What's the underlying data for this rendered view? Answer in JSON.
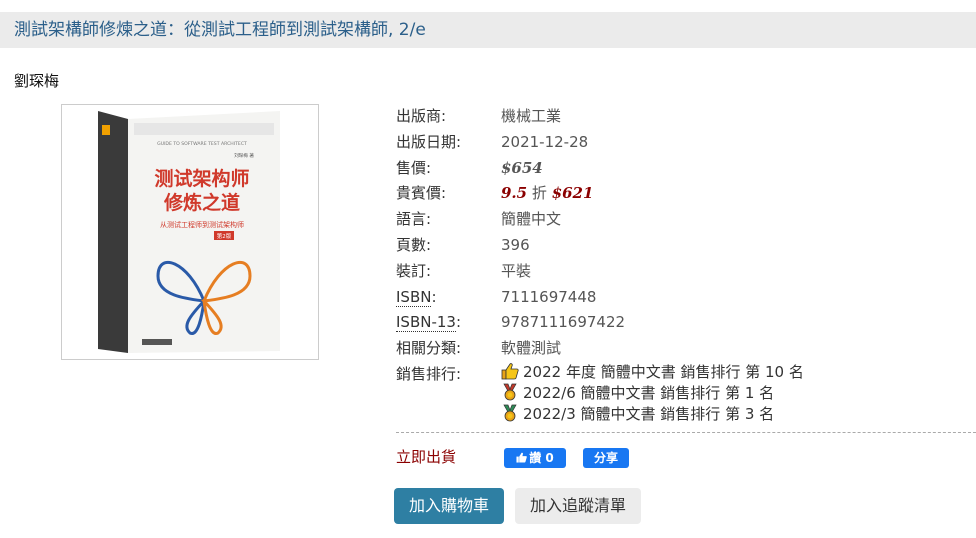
{
  "book": {
    "title": "測試架構師修煉之道：從測試工程師到測試架構師, 2/e",
    "author": "劉琛梅",
    "cover": {
      "title_line1": "测试架构师",
      "title_line2": "修炼之道",
      "en_subtitle": "GUIDE TO SOFTWARE TEST ARCHITECT",
      "cn_subtitle": "从测试工程师到测试架构师",
      "edition": "第2版",
      "author_line": "刘琛梅 著"
    }
  },
  "details": {
    "publisher": {
      "label": "出版商:",
      "value": "機械工業"
    },
    "pub_date": {
      "label": "出版日期:",
      "value": "2021-12-28"
    },
    "price": {
      "label": "售價:",
      "value": "$654"
    },
    "vip_price": {
      "label": "貴賓價:",
      "discount": "9.5",
      "discount_unit": "折",
      "value": "$621"
    },
    "language": {
      "label": "語言:",
      "value": "簡體中文"
    },
    "pages": {
      "label": "頁數:",
      "value": "396"
    },
    "binding": {
      "label": "裝訂:",
      "value": "平裝"
    },
    "isbn": {
      "label": "ISBN",
      "colon": ":",
      "value": "7111697448"
    },
    "isbn13": {
      "label": "ISBN-13",
      "colon": ":",
      "value": "9787111697422"
    },
    "category": {
      "label": "相關分類:",
      "value": "軟體測試"
    },
    "rankings": {
      "label": "銷售排行:",
      "items": [
        {
          "icon": "thumbs-up-icon",
          "text": "2022 年度 簡體中文書 銷售排行 第 10 名"
        },
        {
          "icon": "medal-icon",
          "text": "2022/6 簡體中文書 銷售排行 第 1 名"
        },
        {
          "icon": "medal-icon",
          "text": "2022/3 簡體中文書 銷售排行 第 3 名"
        }
      ]
    }
  },
  "stock_status": "立即出貨",
  "social": {
    "like_label": "讚 0",
    "share_label": "分享"
  },
  "actions": {
    "add_to_cart": "加入購物車",
    "add_to_wishlist": "加入追蹤清單"
  },
  "colors": {
    "title_link": "#2b5f8a",
    "price": "#8b0000",
    "cart_button": "#2e7fa3",
    "facebook": "#1877f2"
  }
}
